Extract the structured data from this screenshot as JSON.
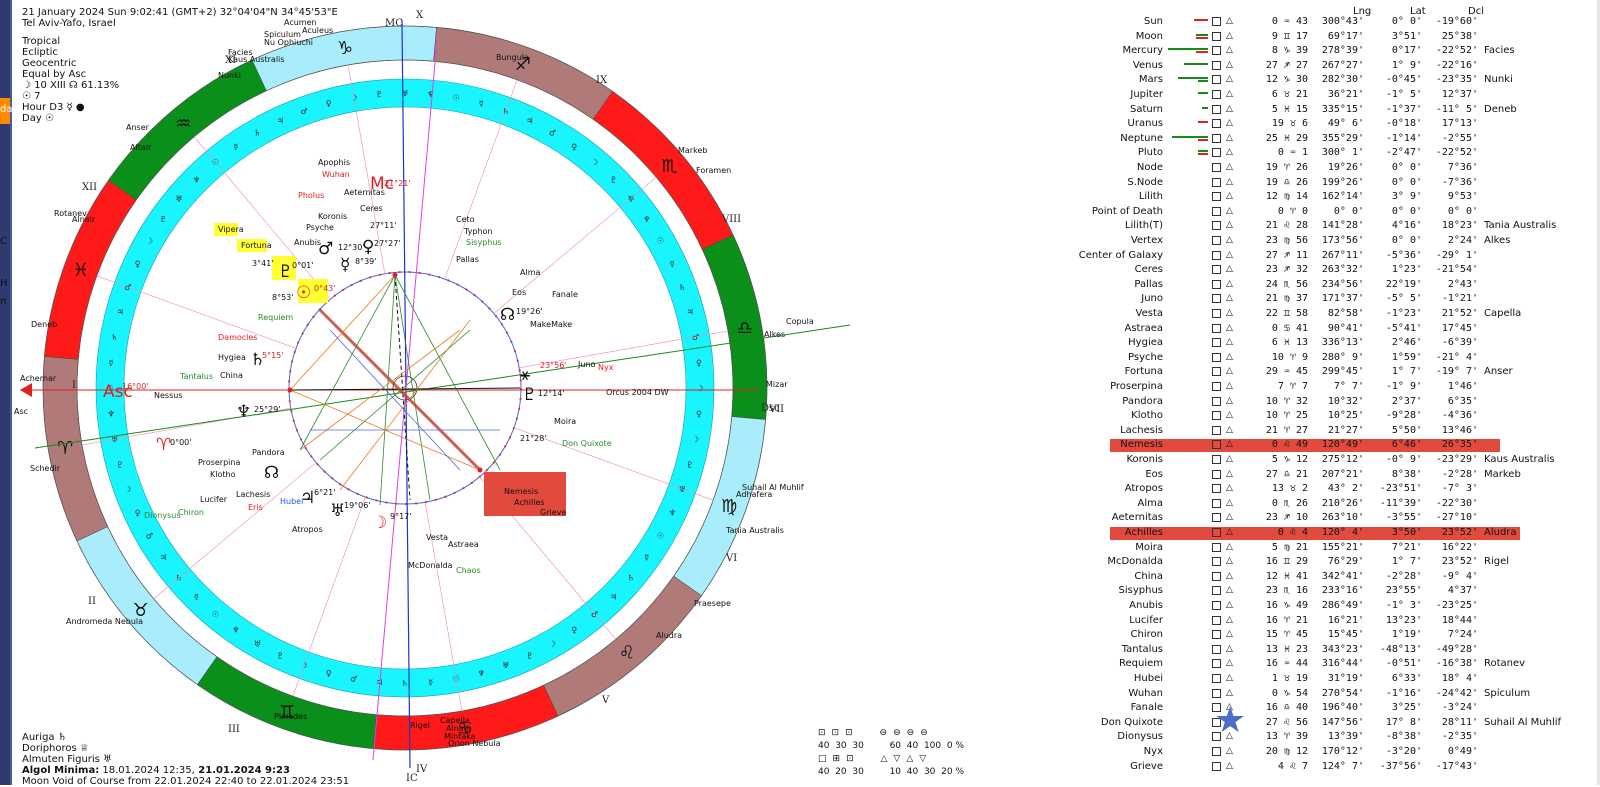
{
  "header": {
    "date_line": "21 January 2024  Sun   9:02:41 (GMT+2) 32°04'04\"N  34°45'53\"E",
    "location": "Tel Aviv-Yafo, Israel",
    "zodiac": "Tropical",
    "ecliptic": "Ecliptic",
    "geocentric": "Geocentric",
    "houses": "Equal by Asc",
    "moon_phase": "☽  10 XIII  ☊ 61.13%",
    "day_number": "☉  7",
    "hour": "Hour D3 ☿ ●",
    "day": "Day ☉"
  },
  "left_stubs": [
    "da",
    "C",
    "H",
    "n"
  ],
  "footer": {
    "auriga": "Auriga  ♄",
    "doriphoros": "Doriphoros  ♕",
    "almuten": "Almuten Figuris  ♅",
    "algol_label": "Algol Minima:",
    "algol_value": " 18.01.2024 12:35,",
    "algol_bold": " 21.01.2024  9:23",
    "void": "Moon Void of Course from 22.01.2024 22:40 to 22.01.2024 23:51"
  },
  "chart": {
    "mc_label": "MC",
    "ic_label": "IC",
    "asc_label": "Asc",
    "dsc_label": "Dsc",
    "x_label": "X",
    "house_labels": [
      "XII",
      "XI",
      "IX",
      "VIII",
      "VII",
      "VI",
      "V",
      "IV",
      "III",
      "II",
      "I"
    ],
    "asc_degree": "16°00'",
    "mc_degree": "21°21'",
    "fixed_stars": [
      "Aculeus",
      "Acumen",
      "Spiculum",
      "Nu Ophiuchi",
      "Facies",
      "Kaus Australis",
      "Nunki",
      "Anser",
      "Altair",
      "Rotanev",
      "Alnair",
      "Deneb",
      "Achernar",
      "Schedir",
      "Andromeda Nebula",
      "Capella",
      "Alnath",
      "Mintaka",
      "Orion Nebula",
      "Rigel",
      "Pleiades",
      "Praesepe",
      "Aludra",
      "Suhail Al Muhlif",
      "Adhafera",
      "Tania Australis",
      "Mizar",
      "Alkes",
      "Copula",
      "Foramen",
      "Markeb",
      "Bungula",
      "Orcus 2004 DW",
      "Don Quixote",
      "Moira",
      "Nyx",
      "Juno",
      "Fanale",
      "MakeMake",
      "Eos",
      "Alma",
      "Ceto",
      "Typhon",
      "Sisyphus",
      "Pallas",
      "Ceres",
      "Aeternitas",
      "Apophis",
      "Wuhan",
      "Pholus",
      "Koronis",
      "Psyche",
      "Anubis",
      "Vipera",
      "Fortuna",
      "Requiem",
      "Damocles",
      "Hygiea",
      "Tantalus",
      "China",
      "Nessus",
      "Pandora",
      "Proserpina",
      "Klotho",
      "Lachesis",
      "Lucifer",
      "Hubei",
      "Eris",
      "Chiron",
      "Dionysus",
      "Atropos",
      "Vesta",
      "Astraea",
      "McDonalda",
      "Chaos",
      "Nemesis",
      "Achilles",
      "Grieve"
    ],
    "planet_degrees": [
      "0°43'",
      "8°53'",
      "3°41'",
      "0°01'",
      "12°30'",
      "27°27'",
      "8°39'",
      "27°11'",
      "19°26'",
      "23°56'",
      "12°14'",
      "21°28'",
      "6°21'",
      "19°06'",
      "9°17'",
      "25°29'",
      "5°15'",
      "0°00'"
    ]
  },
  "table": {
    "headers": {
      "lng": "Lng",
      "lat": "Lat",
      "dcl": "Dcl"
    },
    "rows": [
      {
        "name": "Sun",
        "deg": "0 ♒ 43",
        "lng": "300°43'",
        "lat": "0° 0'",
        "dcl": "-19°60'",
        "star": ""
      },
      {
        "name": "Moon",
        "deg": "9 ♊ 17",
        "lng": "69°17'",
        "lat": "3°51'",
        "dcl": "25°38'",
        "star": ""
      },
      {
        "name": "Mercury",
        "deg": "8 ♑ 39",
        "lng": "278°39'",
        "lat": "0°17'",
        "dcl": "-22°52'",
        "star": "Facies"
      },
      {
        "name": "Venus",
        "deg": "27 ♐ 27",
        "lng": "267°27'",
        "lat": "1° 9'",
        "dcl": "-22°16'",
        "star": ""
      },
      {
        "name": "Mars",
        "deg": "12 ♑ 30",
        "lng": "282°30'",
        "lat": "-0°45'",
        "dcl": "-23°35'",
        "star": "Nunki"
      },
      {
        "name": "Jupiter",
        "deg": "6 ♉ 21",
        "lng": "36°21'",
        "lat": "-1° 5'",
        "dcl": "12°37'",
        "star": ""
      },
      {
        "name": "Saturn",
        "deg": "5 ♓ 15",
        "lng": "335°15'",
        "lat": "-1°37'",
        "dcl": "-11° 5'",
        "star": "Deneb"
      },
      {
        "name": "Uranus",
        "deg": "19 ♉ 6",
        "lng": "49° 6'",
        "lat": "-0°18'",
        "dcl": "17°13'",
        "star": ""
      },
      {
        "name": "Neptune",
        "deg": "25 ♓ 29",
        "lng": "355°29'",
        "lat": "-1°14'",
        "dcl": "-2°55'",
        "star": ""
      },
      {
        "name": "Pluto",
        "deg": "0 ♒ 1",
        "lng": "300° 1'",
        "lat": "-2°47'",
        "dcl": "-22°52'",
        "star": ""
      },
      {
        "name": "Node",
        "deg": "19 ♈ 26",
        "lng": "19°26'",
        "lat": "0° 0'",
        "dcl": "7°36'",
        "star": ""
      },
      {
        "name": "S.Node",
        "deg": "19 ♎ 26",
        "lng": "199°26'",
        "lat": "0° 0'",
        "dcl": "-7°36'",
        "star": ""
      },
      {
        "name": "Lilith",
        "deg": "12 ♍ 14",
        "lng": "162°14'",
        "lat": "3° 9'",
        "dcl": "9°53'",
        "star": ""
      },
      {
        "name": "Point of Death",
        "deg": "0 ♈ 0",
        "lng": "0° 0'",
        "lat": "0° 0'",
        "dcl": "0° 0'",
        "star": ""
      },
      {
        "name": "Lilith(T)",
        "deg": "21 ♌ 28",
        "lng": "141°28'",
        "lat": "4°16'",
        "dcl": "18°23'",
        "star": "Tania Australis"
      },
      {
        "name": "Vertex",
        "deg": "23 ♍ 56",
        "lng": "173°56'",
        "lat": "0° 0'",
        "dcl": "2°24'",
        "star": "Alkes"
      },
      {
        "name": "Center of Galaxy",
        "deg": "27 ♐ 11",
        "lng": "267°11'",
        "lat": "-5°36'",
        "dcl": "-29° 1'",
        "star": ""
      },
      {
        "name": "Ceres",
        "deg": "23 ♐ 32",
        "lng": "263°32'",
        "lat": "1°23'",
        "dcl": "-21°54'",
        "star": ""
      },
      {
        "name": "Pallas",
        "deg": "24 ♏ 56",
        "lng": "234°56'",
        "lat": "22°19'",
        "dcl": "2°43'",
        "star": ""
      },
      {
        "name": "Juno",
        "deg": "21 ♍ 37",
        "lng": "171°37'",
        "lat": "-5° 5'",
        "dcl": "-1°21'",
        "star": ""
      },
      {
        "name": "Vesta",
        "deg": "22 ♊ 58",
        "lng": "82°58'",
        "lat": "-1°23'",
        "dcl": "21°52'",
        "star": "Capella"
      },
      {
        "name": "Astraea",
        "deg": "0 ♋ 41",
        "lng": "90°41'",
        "lat": "-5°41'",
        "dcl": "17°45'",
        "star": ""
      },
      {
        "name": "Hygiea",
        "deg": "6 ♓ 13",
        "lng": "336°13'",
        "lat": "2°46'",
        "dcl": "-6°39'",
        "star": ""
      },
      {
        "name": "Psyche",
        "deg": "10 ♈ 9",
        "lng": "280° 9'",
        "lat": "1°59'",
        "dcl": "-21° 4'",
        "star": ""
      },
      {
        "name": "Fortuna",
        "deg": "29 ♒ 45",
        "lng": "299°45'",
        "lat": "1° 7'",
        "dcl": "-19° 7'",
        "star": "Anser"
      },
      {
        "name": "Proserpina",
        "deg": "7 ♈ 7",
        "lng": "7° 7'",
        "lat": "-1° 9'",
        "dcl": "1°46'",
        "star": ""
      },
      {
        "name": "Pandora",
        "deg": "10 ♈ 32",
        "lng": "10°32'",
        "lat": "2°37'",
        "dcl": "6°35'",
        "star": ""
      },
      {
        "name": "Klotho",
        "deg": "10 ♈ 25",
        "lng": "10°25'",
        "lat": "-9°28'",
        "dcl": "-4°36'",
        "star": ""
      },
      {
        "name": "Lachesis",
        "deg": "21 ♈ 27",
        "lng": "21°27'",
        "lat": "5°50'",
        "dcl": "13°46'",
        "star": ""
      },
      {
        "name": "Nemesis",
        "deg": "0 ♌ 49",
        "lng": "120°49'",
        "lat": "6°46'",
        "dcl": "26°35'",
        "star": "",
        "hl": 1
      },
      {
        "name": "Koronis",
        "deg": "5 ♑ 12",
        "lng": "275°12'",
        "lat": "-0° 9'",
        "dcl": "-23°29'",
        "star": "Kaus Australis"
      },
      {
        "name": "Eos",
        "deg": "27 ♎ 21",
        "lng": "207°21'",
        "lat": "8°38'",
        "dcl": "-2°28'",
        "star": "Markeb"
      },
      {
        "name": "Atropos",
        "deg": "13 ♉ 2",
        "lng": "43° 2'",
        "lat": "-23°51'",
        "dcl": "-7° 3'",
        "star": ""
      },
      {
        "name": "Alma",
        "deg": "0 ♏ 26",
        "lng": "210°26'",
        "lat": "-11°39'",
        "dcl": "-22°30'",
        "star": ""
      },
      {
        "name": "Aeternitas",
        "deg": "23 ♐ 10",
        "lng": "263°10'",
        "lat": "-3°55'",
        "dcl": "-27°10'",
        "star": ""
      },
      {
        "name": "Achilles",
        "deg": "0 ♌ 4",
        "lng": "120° 4'",
        "lat": "3°50'",
        "dcl": "23°52'",
        "star": "Aludra",
        "hl": 2
      },
      {
        "name": "Moira",
        "deg": "5 ♍ 21",
        "lng": "155°21'",
        "lat": "7°21'",
        "dcl": "16°22'",
        "star": ""
      },
      {
        "name": "McDonalda",
        "deg": "16 ♊ 29",
        "lng": "76°29'",
        "lat": "1° 7'",
        "dcl": "23°52'",
        "star": "Rigel"
      },
      {
        "name": "China",
        "deg": "12 ♓ 41",
        "lng": "342°41'",
        "lat": "-2°28'",
        "dcl": "-9° 4'",
        "star": ""
      },
      {
        "name": "Sisyphus",
        "deg": "23 ♏ 16",
        "lng": "233°16'",
        "lat": "23°55'",
        "dcl": "4°37'",
        "star": ""
      },
      {
        "name": "Anubis",
        "deg": "16 ♑ 49",
        "lng": "286°49'",
        "lat": "-1° 3'",
        "dcl": "-23°25'",
        "star": ""
      },
      {
        "name": "Lucifer",
        "deg": "16 ♈ 21",
        "lng": "16°21'",
        "lat": "13°23'",
        "dcl": "18°44'",
        "star": ""
      },
      {
        "name": "Chiron",
        "deg": "15 ♈ 45",
        "lng": "15°45'",
        "lat": "1°19'",
        "dcl": "7°24'",
        "star": ""
      },
      {
        "name": "Tantalus",
        "deg": "13 ♓ 23",
        "lng": "343°23'",
        "lat": "-48°13'",
        "dcl": "-49°28'",
        "star": ""
      },
      {
        "name": "Requiem",
        "deg": "16 ♒ 44",
        "lng": "316°44'",
        "lat": "-0°51'",
        "dcl": "-16°38'",
        "star": "Rotanev"
      },
      {
        "name": "Hubei",
        "deg": "1 ♉ 19",
        "lng": "31°19'",
        "lat": "6°33'",
        "dcl": "18° 4'",
        "star": ""
      },
      {
        "name": "Wuhan",
        "deg": "0 ♑ 54",
        "lng": "270°54'",
        "lat": "-1°16'",
        "dcl": "-24°42'",
        "star": "Spiculum"
      },
      {
        "name": "Fanale",
        "deg": "16 ♎ 40",
        "lng": "196°40'",
        "lat": "3°25'",
        "dcl": "-3°24'",
        "star": ""
      },
      {
        "name": "Don Quixote",
        "deg": "27 ♌ 56",
        "lng": "147°56'",
        "lat": "17° 8'",
        "dcl": "28°11'",
        "star": "Suhail Al Muhlif"
      },
      {
        "name": "Dionysus",
        "deg": "13 ♈ 39",
        "lng": "13°39'",
        "lat": "-8°38'",
        "dcl": "-2°35'",
        "star": ""
      },
      {
        "name": "Nyx",
        "deg": "20 ♍ 12",
        "lng": "170°12'",
        "lat": "-3°20'",
        "dcl": "0°49'",
        "star": ""
      },
      {
        "name": "Grieve",
        "deg": "4 ♌ 7",
        "lng": "124° 7'",
        "lat": "-37°56'",
        "dcl": "-17°43'",
        "star": ""
      }
    ]
  },
  "controls": {
    "row1": [
      "40",
      "30",
      "30"
    ],
    "row1b": [
      "60",
      "40",
      "100",
      "0 %"
    ],
    "row2": [
      "40",
      "20",
      "30"
    ],
    "row2b": [
      "10",
      "40",
      "30",
      "20 %"
    ]
  },
  "colors": {
    "cyan_ring": "#19f5ff",
    "red_sign": "#ff1a1a",
    "green_sign": "#0a8f1a",
    "brown_sign": "#b07a78",
    "light_blue": "#a9ecfb",
    "nemesis_box": "#e34a3e",
    "highlight_row": "#e34a3e",
    "accent": "#4a5da3"
  }
}
